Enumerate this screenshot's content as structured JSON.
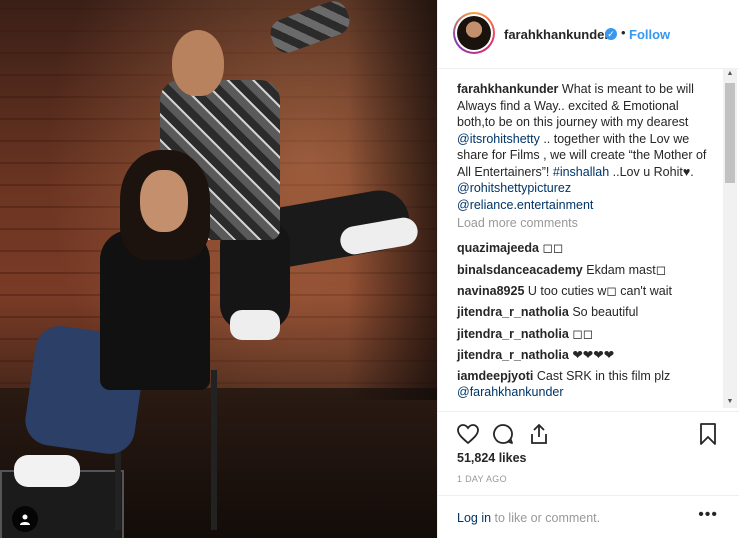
{
  "post": {
    "username": "farahkhankunder",
    "verified_icon": "verified-badge-icon",
    "dot": "•",
    "follow_label": "Follow",
    "caption_user": "farahkhankunder",
    "caption_text_1": " What is meant to be will Always find a Way.. excited & Emotional both,to be on this journey with my dearest ",
    "caption_mention_1": "@itsrohitshetty",
    "caption_text_2": " .. together with the Lov we share for Films , we will create “the Mother of All Entertainers”! ",
    "caption_hashtag": "#inshallah",
    "caption_text_3": " ..Lov u Rohit♥. ",
    "caption_mention_2": "@rohitshettypicturez",
    "caption_mention_3": "@reliance.entertainment",
    "load_more": "Load more comments",
    "comments": [
      {
        "user": "quazimajeeda",
        "text": " ◻◻"
      },
      {
        "user": "binalsdanceacademy",
        "text": " Ekdam mast◻"
      },
      {
        "user": "navina8925",
        "text": " U too cuties w◻ can't wait"
      },
      {
        "user": "jitendra_r_natholia",
        "text": " So beautiful"
      },
      {
        "user": "jitendra_r_natholia",
        "text": " ◻◻"
      },
      {
        "user": "jitendra_r_natholia",
        "text": " ❤❤❤❤"
      },
      {
        "user": "iamdeepjyoti",
        "text": " Cast SRK in this film plz"
      },
      {
        "user": "@farahkhankunder",
        "text": ""
      }
    ],
    "likes": "51,824 likes",
    "time": "1 DAY AGO",
    "login_link": "Log in",
    "login_rest": " to like or comment.",
    "more_options": "•••"
  },
  "colors": {
    "link": "#003569",
    "follow": "#3897f0",
    "muted": "#999999"
  }
}
